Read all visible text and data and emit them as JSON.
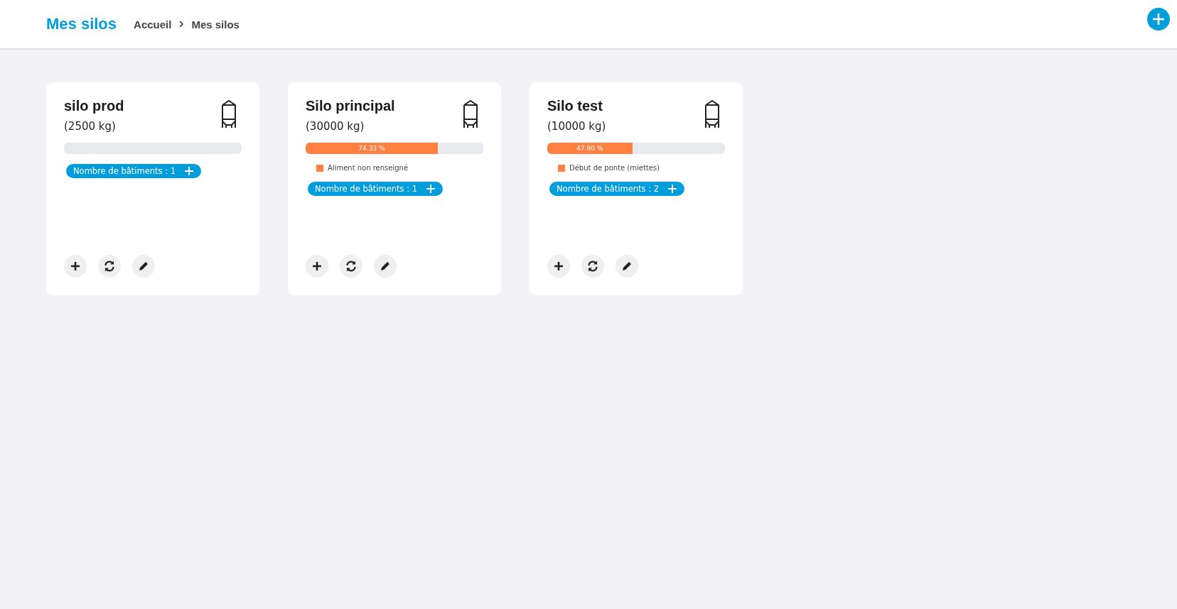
{
  "header": {
    "title": "Mes silos",
    "breadcrumb": [
      "Accueil",
      "Mes silos"
    ]
  },
  "silos": [
    {
      "name": "silo prod",
      "capacity": "(2500 kg)",
      "buildings": "Nombre de bâtiments : 1"
    },
    {
      "name": "Silo principal",
      "capacity": "(30000 kg)",
      "level": 0.7433,
      "percent": "74.33 %",
      "feed": {
        "label": "Aliment non renseigné",
        "color": "#ff8040"
      },
      "buildings": "Nombre de bâtiments : 1"
    },
    {
      "name": "Silo test",
      "capacity": "(10000 kg)",
      "level": 0.479,
      "percent": "47.90 %",
      "feed": {
        "label": "Début de ponte (miettes)",
        "color": "#ff8040"
      },
      "buildings": "Nombre de bâtiments : 2"
    }
  ]
}
